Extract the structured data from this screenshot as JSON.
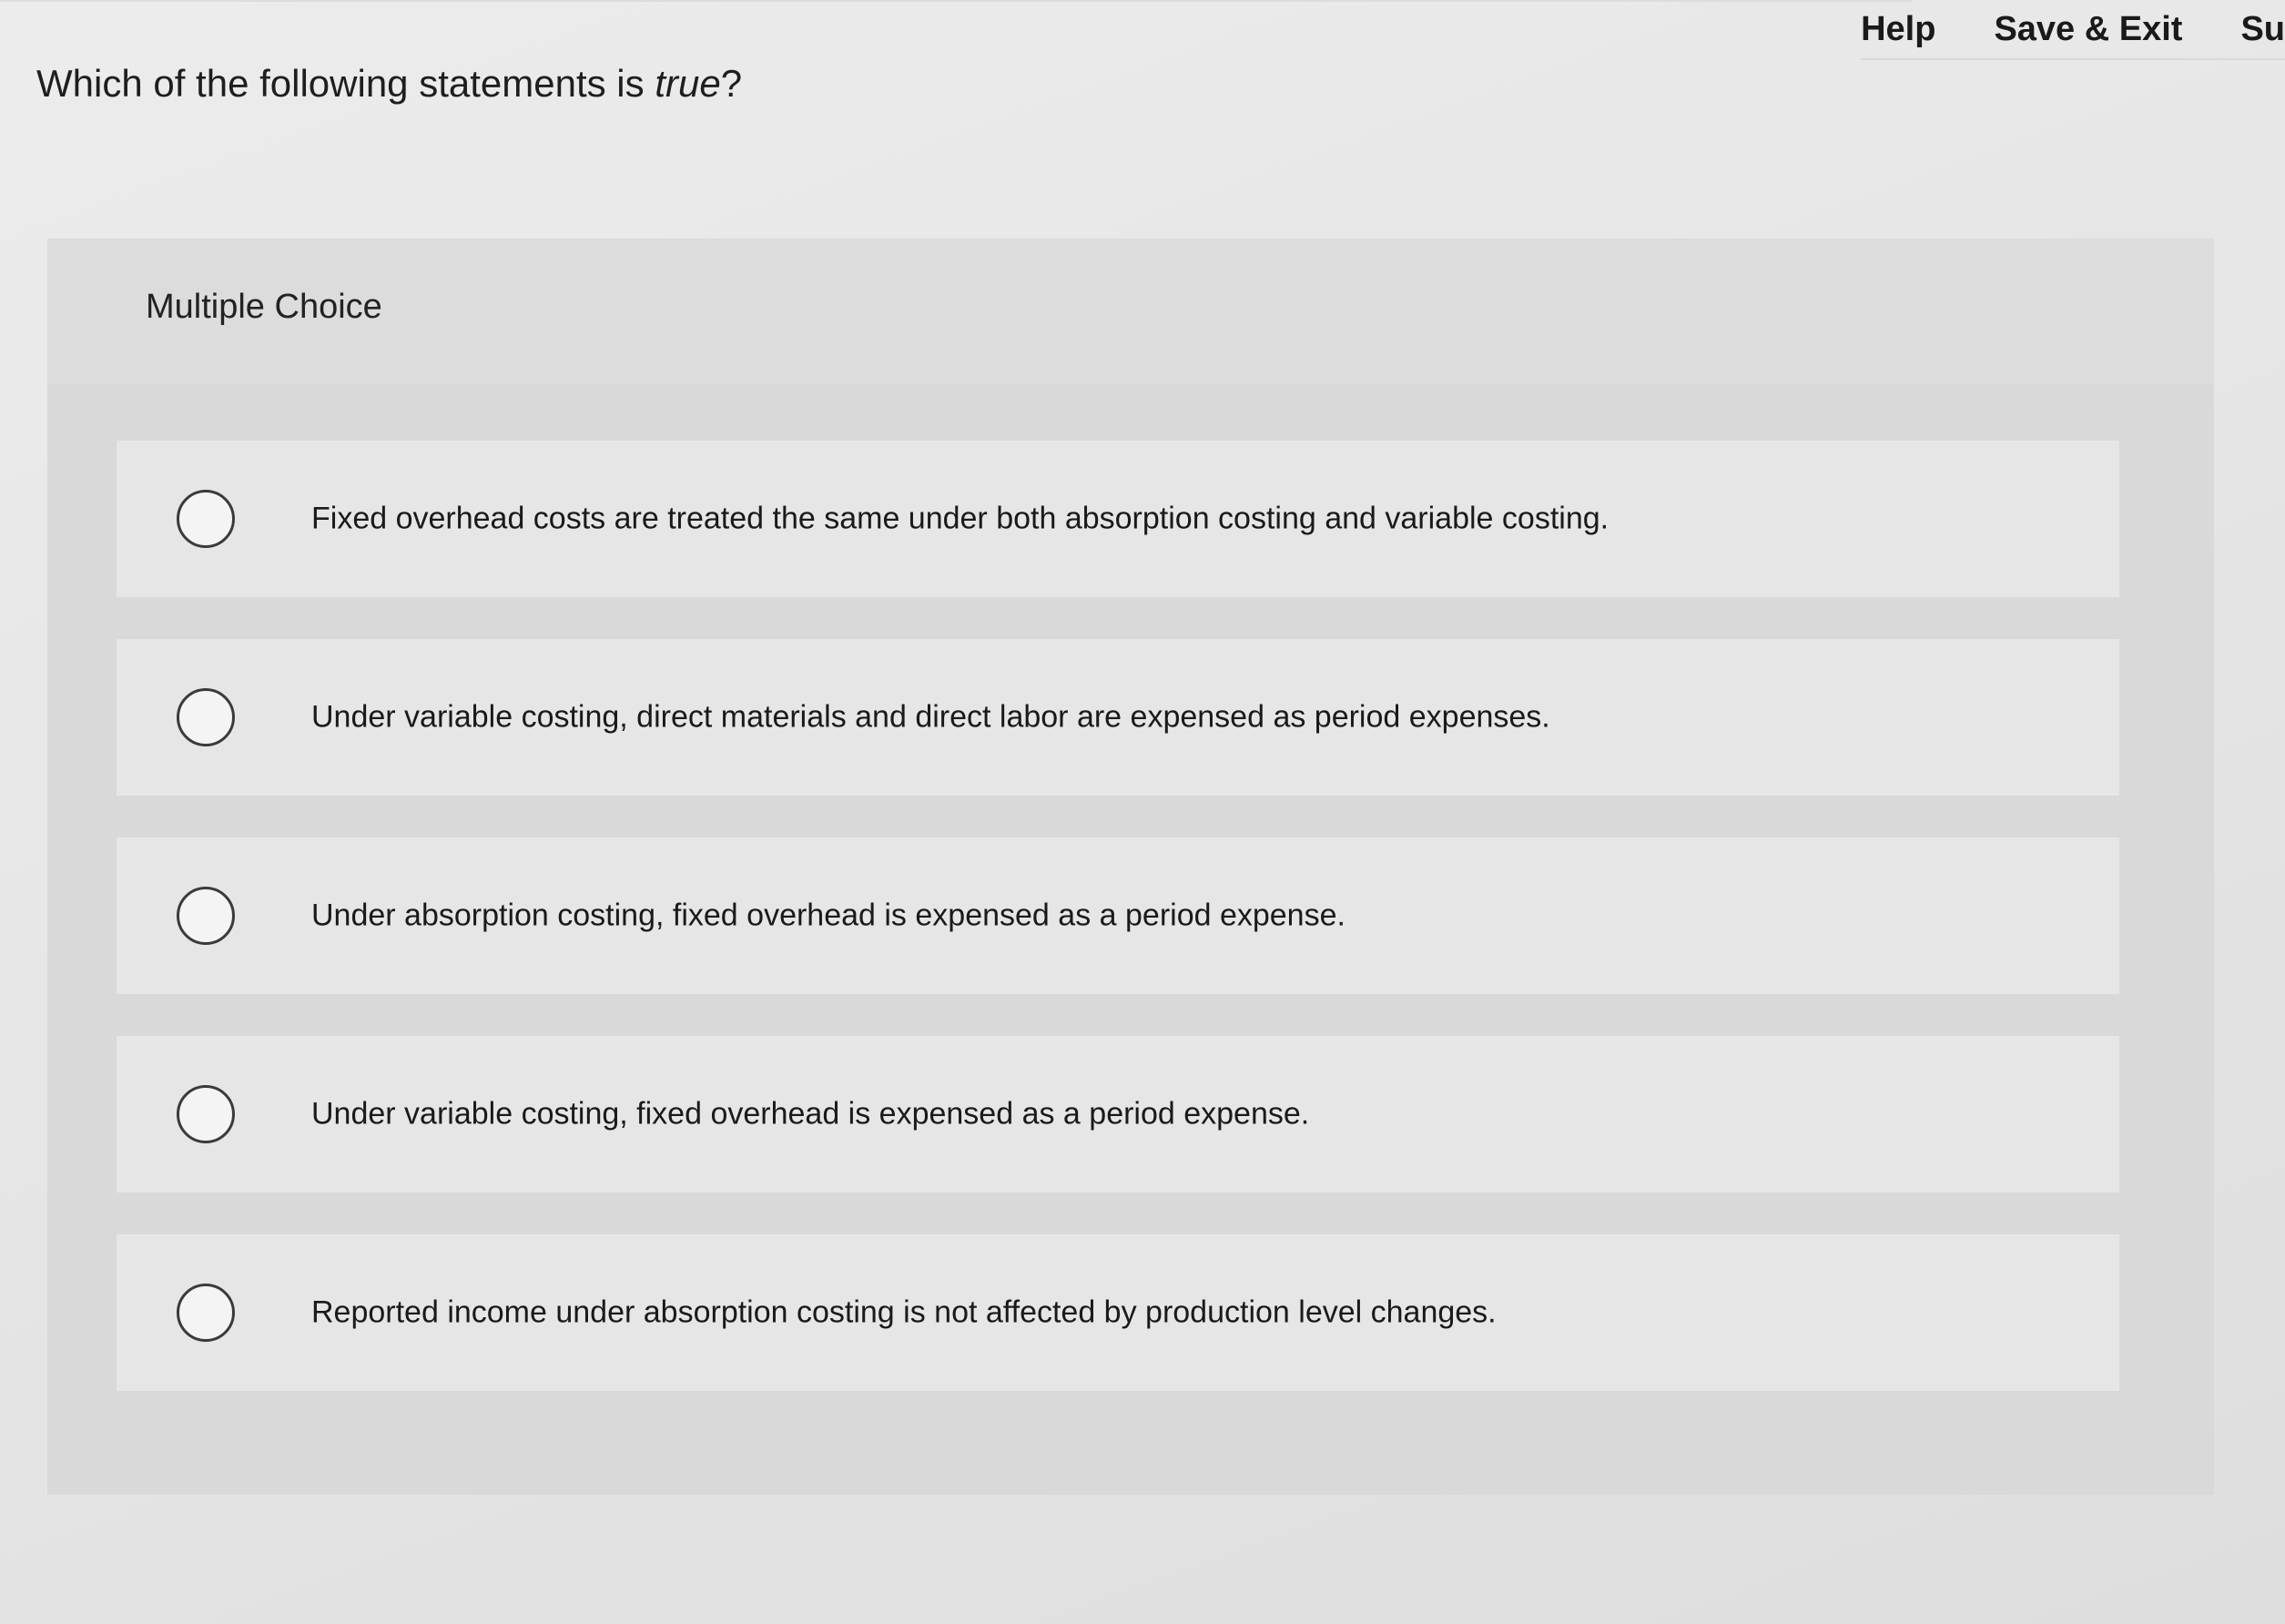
{
  "topbar": {
    "help_label": "Help",
    "save_exit_label": "Save & Exit",
    "submit_label_partial": "Su"
  },
  "question": {
    "prefix": "Which of the following statements is ",
    "emphasis": "true",
    "suffix": "?"
  },
  "multiple_choice": {
    "title": "Multiple Choice",
    "options": [
      {
        "label": "Fixed overhead costs are treated the same under both absorption costing and variable costing.",
        "selected": false
      },
      {
        "label": "Under variable costing, direct materials and direct labor are expensed as period expenses.",
        "selected": false
      },
      {
        "label": "Under absorption costing, fixed overhead is expensed as a period expense.",
        "selected": false
      },
      {
        "label": "Under variable costing, fixed overhead is expensed as a period expense.",
        "selected": false
      },
      {
        "label": "Reported income under absorption costing is not affected by production level changes.",
        "selected": false
      }
    ]
  }
}
